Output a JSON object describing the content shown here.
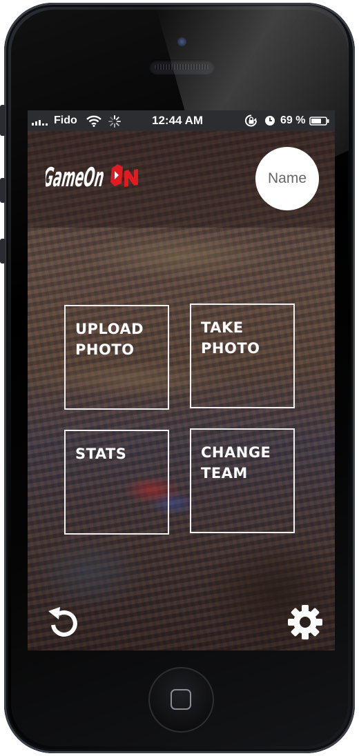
{
  "status_bar": {
    "carrier": "Fido",
    "time": "12:44 AM",
    "battery_percent": "69 %",
    "icons": [
      "signal-bars-icon",
      "wifi-icon",
      "loading-spinner-icon",
      "rotation-lock-icon",
      "alarm-clock-icon",
      "battery-icon"
    ]
  },
  "header": {
    "logo_text": "GameOn",
    "name_button": "Name"
  },
  "tiles": [
    {
      "line1": "UPLOAD",
      "line2": "PHOTO"
    },
    {
      "line1": "TAKE",
      "line2": "PHOTO"
    },
    {
      "line1": "STATS",
      "line2": ""
    },
    {
      "line1": "CHANGE",
      "line2": "TEAM"
    }
  ],
  "toolbar": {
    "left_icon": "refresh-icon",
    "right_icon": "gear-icon"
  },
  "colors": {
    "logo_white": "#ffffff",
    "logo_red": "#e01b22",
    "tile_border": "#f2f2f2",
    "status_bar_bg": "#2b2d31"
  }
}
